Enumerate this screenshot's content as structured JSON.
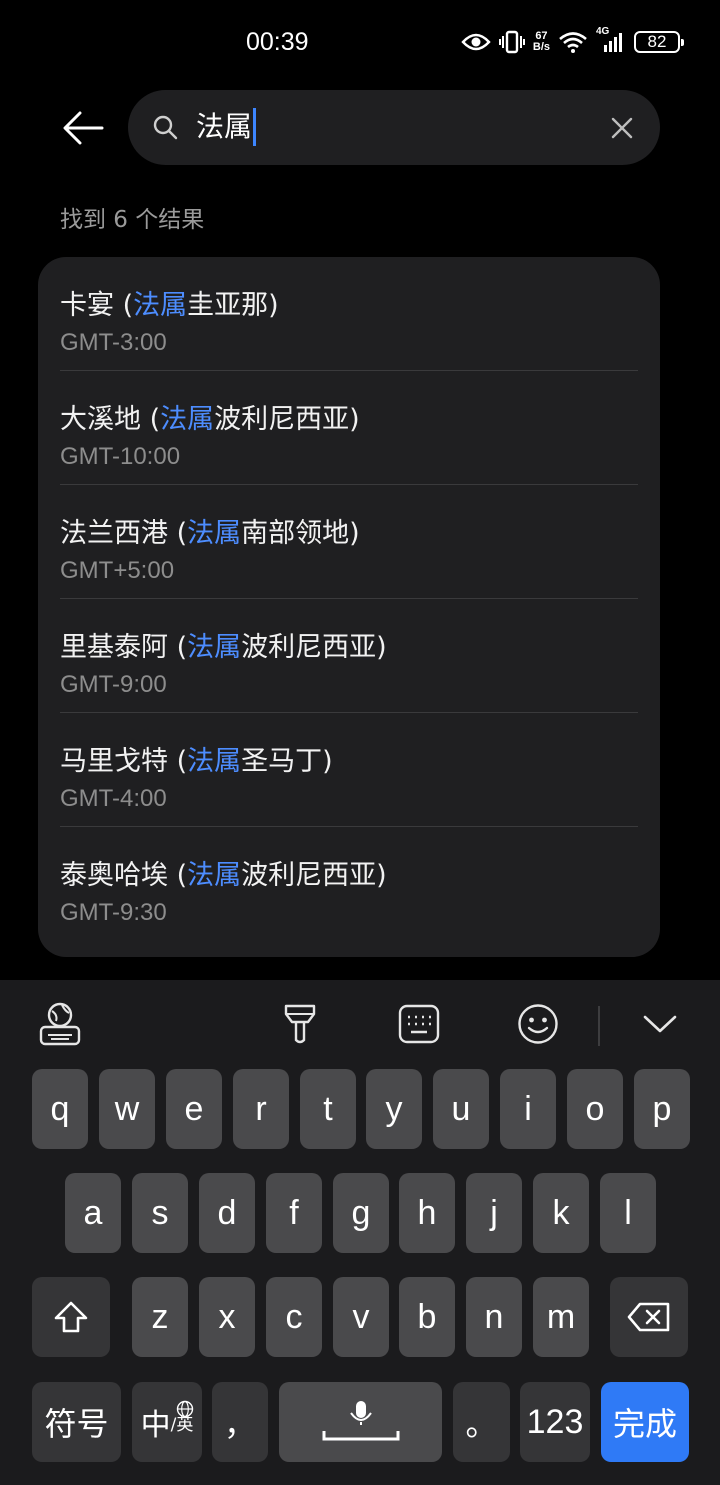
{
  "status_bar": {
    "time": "00:39",
    "net_speed_value": "67",
    "net_speed_unit": "B/s",
    "network": "4G",
    "battery": "82",
    "icons": [
      "eye-icon",
      "vibrate-icon",
      "wifi-icon",
      "signal-icon",
      "battery-icon"
    ]
  },
  "search": {
    "query": "法属",
    "back_icon": "back-arrow-icon",
    "clear_icon": "close-icon"
  },
  "result_count": "找到 6 个结果",
  "highlight_color": "#4d8dff",
  "results": [
    {
      "pre": "卡宴 (",
      "hl": "法属",
      "post": "圭亚那)",
      "tz": "GMT-3:00"
    },
    {
      "pre": "大溪地 (",
      "hl": "法属",
      "post": "波利尼西亚)",
      "tz": "GMT-10:00"
    },
    {
      "pre": "法兰西港 (",
      "hl": "法属",
      "post": "南部领地)",
      "tz": "GMT+5:00"
    },
    {
      "pre": "里基泰阿 (",
      "hl": "法属",
      "post": "波利尼西亚)",
      "tz": "GMT-9:00"
    },
    {
      "pre": "马里戈特 (",
      "hl": "法属",
      "post": "圣马丁)",
      "tz": "GMT-4:00"
    },
    {
      "pre": "泰奥哈埃 (",
      "hl": "法属",
      "post": "波利尼西亚)",
      "tz": "GMT-9:30"
    }
  ],
  "keyboard": {
    "toolbar_icons": [
      "keyboard-globe-icon",
      "brush-icon",
      "keyboard-layout-icon",
      "emoji-icon",
      "collapse-chevron-icon"
    ],
    "row1": [
      "q",
      "w",
      "e",
      "r",
      "t",
      "y",
      "u",
      "i",
      "o",
      "p"
    ],
    "row2": [
      "a",
      "s",
      "d",
      "f",
      "g",
      "h",
      "j",
      "k",
      "l"
    ],
    "row3": [
      "z",
      "x",
      "c",
      "v",
      "b",
      "n",
      "m"
    ],
    "symbols_key": "符号",
    "lang_key_main": "中",
    "lang_key_sub": "/英",
    "comma_key": "，",
    "period_key": "。",
    "numbers_key": "123",
    "done_key": "完成",
    "accent_color": "#2f7af6"
  }
}
